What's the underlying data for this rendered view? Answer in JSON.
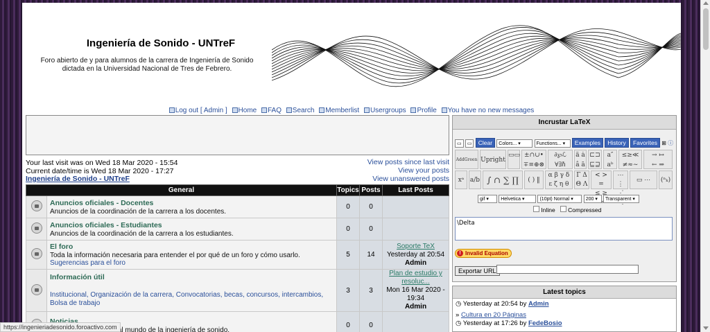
{
  "header": {
    "title": "Ingeniería de Sonido - UNTreF",
    "description": "Foro abierto de y para alumnos de la carrera de Ingeniería de Sonido dictada en la Universidad Nacional de Tres de Febrero."
  },
  "nav": [
    {
      "label": "Log out [ Admin ]",
      "icon": "logout-icon"
    },
    {
      "label": "Home",
      "icon": "home-icon"
    },
    {
      "label": "FAQ",
      "icon": "faq-icon"
    },
    {
      "label": "Search",
      "icon": "search-icon"
    },
    {
      "label": "Memberlist",
      "icon": "memberlist-icon"
    },
    {
      "label": "Usergroups",
      "icon": "usergroups-icon"
    },
    {
      "label": "Profile",
      "icon": "profile-icon"
    },
    {
      "label": "You have no new messages",
      "icon": "messages-icon"
    }
  ],
  "visit": {
    "last_visit": "Your last visit was on Wed 18 Mar 2020 - 15:54",
    "current": "Current date/time is Wed 18 Mar 2020 - 17:27",
    "forum_link": "Ingeniería de Sonido - UNTreF",
    "links": [
      "View posts since last visit",
      "View your posts",
      "View unanswered posts"
    ]
  },
  "table": {
    "headers": {
      "general": "General",
      "topics": "Topics",
      "posts": "Posts",
      "last": "Last Posts"
    },
    "rows": [
      {
        "name": "Anuncios oficiales - Docentes",
        "desc": "Anuncios de la coordinación de la carrera a los docentes.",
        "topics": "0",
        "posts": "0"
      },
      {
        "name": "Anuncios oficiales - Estudiantes",
        "desc": "Anuncios de la coordinación de la carrera a los estudiantes.",
        "topics": "0",
        "posts": "0"
      },
      {
        "name": "El foro",
        "desc": "Toda la información necesaria para entender el por qué de un foro y cómo usarlo.",
        "subforum": "Sugerencias para el foro",
        "topics": "5",
        "posts": "14",
        "last_title": "Soporte TeX",
        "last_date": "Yesterday at 20:54",
        "last_author": "Admin"
      },
      {
        "name": "Información útil",
        "subforums": [
          "Institucional,",
          "Organización de la carrera,",
          "Convocatorias, becas, concursos, intercambios,",
          "Bolsa de trabajo"
        ],
        "topics": "3",
        "posts": "3",
        "last_title": "Plan de estudio y resoluc...",
        "last_date": "Mon 16 Mar 2020 - 19:34",
        "last_author": "Admin"
      },
      {
        "name": "Noticias",
        "desc": "Noticias relacionadas al mundo de la ingeniería de sonido.",
        "topics": "0",
        "posts": "0"
      }
    ]
  },
  "latex": {
    "title": "Incrustar LaTeX",
    "clear": "Clear",
    "colors": "Colors...",
    "functions": "Functions...",
    "examples": "Examples",
    "history": "History",
    "favorites": "Favorites",
    "format": "gif",
    "font": "Helvetica",
    "size": "(10pt) Normal",
    "dpi": "200",
    "background": "Transparent",
    "inline": "Inline",
    "compressed": "Compressed",
    "input_value": "\\Delta",
    "invalid": "Invalid Equation",
    "export": "Exportar URL",
    "upright_label": "Upright",
    "adds_label": "AddGreen"
  },
  "latest": {
    "title": "Latest topics",
    "items": [
      {
        "text": "Yesterday at 20:54 by",
        "author": "Admin"
      },
      {
        "link": "Cultura en 20 Páginas"
      },
      {
        "text": "Yesterday at 17:26 by",
        "author": "FedeBosio"
      }
    ]
  },
  "status_url": "https://ingenieriadesonido.foroactivo.com"
}
